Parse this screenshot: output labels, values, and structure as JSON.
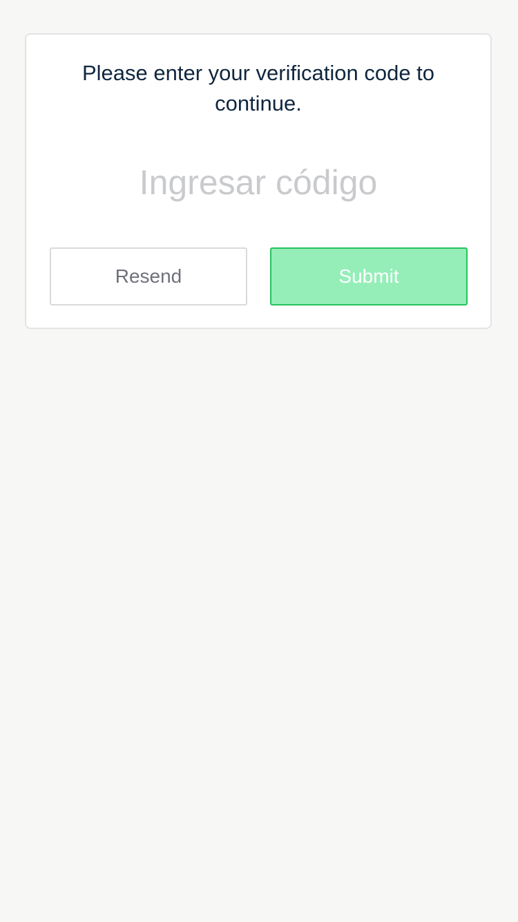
{
  "verification": {
    "prompt": "Please enter your verification code to continue.",
    "code_input": {
      "value": "",
      "placeholder": "Ingresar código"
    },
    "resend_label": "Resend",
    "submit_label": "Submit"
  },
  "colors": {
    "background": "#f7f7f5",
    "text": "#10263e",
    "placeholder": "#c9cacd",
    "submit_fill": "#95eeb8",
    "submit_border": "#27c25d",
    "resend_text": "#6d717a"
  }
}
